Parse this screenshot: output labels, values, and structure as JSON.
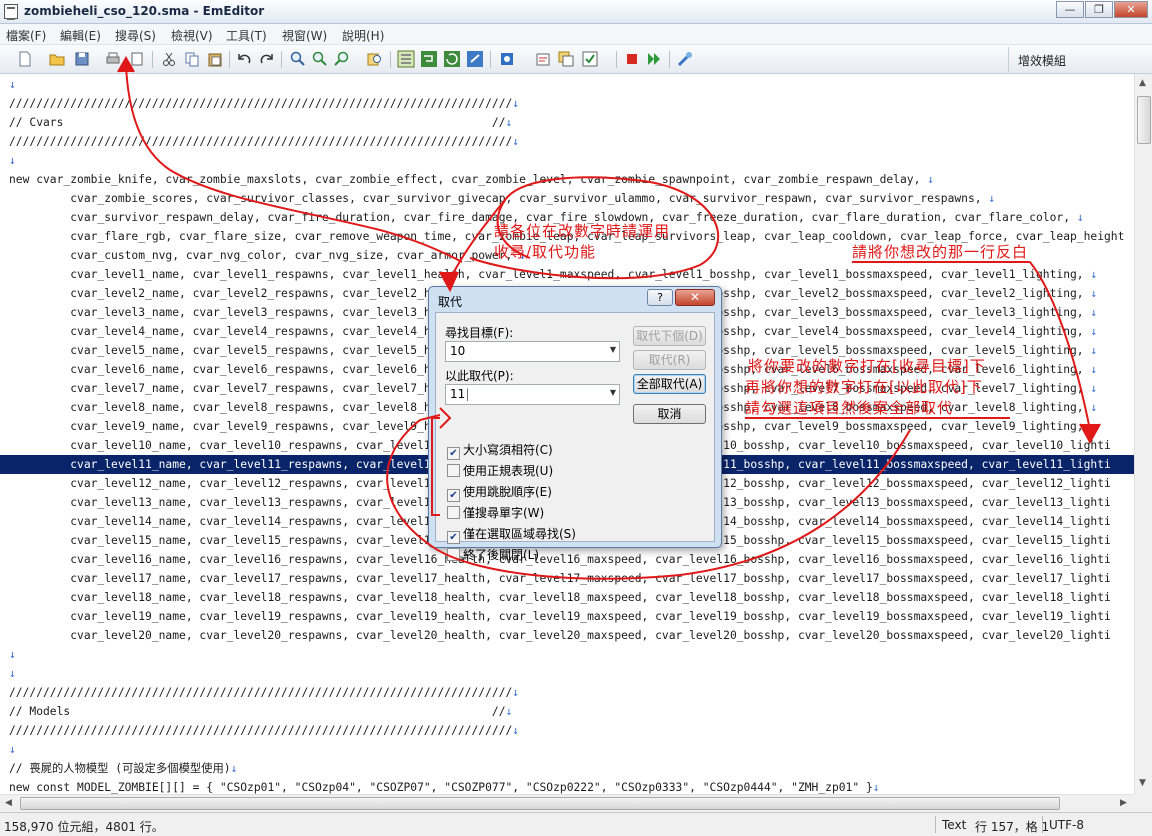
{
  "window": {
    "title": "zombieheli_cso_120.sma - EmEditor",
    "minimize": "—",
    "restore": "❐",
    "close": "✕"
  },
  "menu": [
    "檔案(F)",
    "編輯(E)",
    "搜尋(S)",
    "檢視(V)",
    "工具(T)",
    "視窗(W)",
    "說明(H)"
  ],
  "toolbar": {
    "plugin_panel": "增效模組"
  },
  "editor": {
    "crlf": "↓",
    "lines": [
      "",
      "//////////////////////////////////////////////////////////////////////////",
      "// Cvars                                                               //",
      "//////////////////////////////////////////////////////////////////////////",
      "",
      "new cvar_zombie_knife, cvar_zombie_maxslots, cvar_zombie_effect, cvar_zombie_level, cvar_zombie_spawnpoint, cvar_zombie_respawn_delay, ",
      "         cvar_zombie_scores, cvar_survivor_classes, cvar_survivor_givecap, cvar_survivor_ulammo, cvar_survivor_respawn, cvar_survivor_respawns, ",
      "         cvar_survivor_respawn_delay, cvar_fire_duration, cvar_fire_damage, cvar_fire_slowdown, cvar_freeze_duration, cvar_flare_duration, cvar_flare_color, ",
      "         cvar_flare_rgb, cvar_flare_size, cvar_remove_weapon_time, cvar_zombie_leap, cvar_leap_survivors_leap, cvar_leap_cooldown, cvar_leap_force, cvar_leap_height",
      "         cvar_custom_nvg, cvar_nvg_color, cvar_nvg_size, cvar_armor_power, ",
      "         cvar_level1_name, cvar_level1_respawns, cvar_level1_health, cvar_level1_maxspeed, cvar_level1_bosshp, cvar_level1_bossmaxspeed, cvar_level1_lighting, ",
      "         cvar_level2_name, cvar_level2_respawns, cvar_level2_health, cvar_level2_maxspeed, cvar_level2_bosshp, cvar_level2_bossmaxspeed, cvar_level2_lighting, ",
      "         cvar_level3_name, cvar_level3_respawns, cvar_level3_health, cvar_level3_maxspeed, cvar_level3_bosshp, cvar_level3_bossmaxspeed, cvar_level3_lighting, ",
      "         cvar_level4_name, cvar_level4_respawns, cvar_level4_health, cvar_level4_maxspeed, cvar_level4_bosshp, cvar_level4_bossmaxspeed, cvar_level4_lighting, ",
      "         cvar_level5_name, cvar_level5_respawns, cvar_level5_health, cvar_level5_maxspeed, cvar_level5_bosshp, cvar_level5_bossmaxspeed, cvar_level5_lighting, ",
      "         cvar_level6_name, cvar_level6_respawns, cvar_level6_health, cvar_level6_maxspeed, cvar_level6_bosshp, cvar_level6_bossmaxspeed, cvar_level6_lighting, ",
      "         cvar_level7_name, cvar_level7_respawns, cvar_level7_health, cvar_level7_maxspeed, cvar_level7_bosshp, cvar_level7_bossmaxspeed, cvar_level7_lighting, ",
      "         cvar_level8_name, cvar_level8_respawns, cvar_level8_health, cvar_level8_maxspeed, cvar_level8_bosshp, cvar_level8_bossmaxspeed, cvar_level8_lighting, ",
      "         cvar_level9_name, cvar_level9_respawns, cvar_level9_health, cvar_level9_maxspeed, cvar_level9_bosshp, cvar_level9_bossmaxspeed, cvar_level9_lighting, ",
      "         cvar_level10_name, cvar_level10_respawns, cvar_level10_health, cvar_level10_maxspeed, cvar_level10_bosshp, cvar_level10_bossmaxspeed, cvar_level10_lighti",
      "         cvar_level11_name, cvar_level11_respawns, cvar_level11_health, cvar_level11_maxspeed, cvar_level11_bosshp, cvar_level11_bossmaxspeed, cvar_level11_lighti",
      "         cvar_level12_name, cvar_level12_respawns, cvar_level12_health, cvar_level12_maxspeed, cvar_level12_bosshp, cvar_level12_bossmaxspeed, cvar_level12_lighti",
      "         cvar_level13_name, cvar_level13_respawns, cvar_level13_health, cvar_level13_maxspeed, cvar_level13_bosshp, cvar_level13_bossmaxspeed, cvar_level13_lighti",
      "         cvar_level14_name, cvar_level14_respawns, cvar_level14_health, cvar_level14_maxspeed, cvar_level14_bosshp, cvar_level14_bossmaxspeed, cvar_level14_lighti",
      "         cvar_level15_name, cvar_level15_respawns, cvar_level15_health, cvar_level15_maxspeed, cvar_level15_bosshp, cvar_level15_bossmaxspeed, cvar_level15_lighti",
      "         cvar_level16_name, cvar_level16_respawns, cvar_level16_health, cvar_level16_maxspeed, cvar_level16_bosshp, cvar_level16_bossmaxspeed, cvar_level16_lighti",
      "         cvar_level17_name, cvar_level17_respawns, cvar_level17_health, cvar_level17_maxspeed, cvar_level17_bosshp, cvar_level17_bossmaxspeed, cvar_level17_lighti",
      "         cvar_level18_name, cvar_level18_respawns, cvar_level18_health, cvar_level18_maxspeed, cvar_level18_bosshp, cvar_level18_bossmaxspeed, cvar_level18_lighti",
      "         cvar_level19_name, cvar_level19_respawns, cvar_level19_health, cvar_level19_maxspeed, cvar_level19_bosshp, cvar_level19_bossmaxspeed, cvar_level19_lighti",
      "         cvar_level20_name, cvar_level20_respawns, cvar_level20_health, cvar_level20_maxspeed, cvar_level20_bosshp, cvar_level20_bossmaxspeed, cvar_level20_lighti",
      "",
      "",
      "//////////////////////////////////////////////////////////////////////////",
      "// Models                                                              //",
      "//////////////////////////////////////////////////////////////////////////",
      "",
      "// 喪屍的人物模型 (可設定多個模型使用)",
      "new const MODEL_ZOMBIE[][] = { \"CSOzp01\", \"CSOzp04\", \"CSOZP07\", \"CSOZP077\", \"CSOzp0222\", \"CSOzp0333\", \"CSOzp0444\", \"ZMH_zp01\" }"
    ],
    "selected_line": 20,
    "no_crlf_lines": [
      8,
      19,
      20,
      21,
      22,
      23,
      24,
      25,
      26,
      27,
      28,
      29
    ]
  },
  "dialog": {
    "title": "取代",
    "help": "?",
    "close": "✕",
    "find_label": "尋找目標(F):",
    "find_value": "10",
    "replace_label": "以此取代(P):",
    "replace_value": "11",
    "buttons": {
      "replace_next": "取代下個(D)",
      "replace": "取代(R)",
      "replace_all": "全部取代(A)",
      "cancel": "取消"
    },
    "options": [
      {
        "label": "大小寫須相符(C)",
        "checked": true
      },
      {
        "label": "使用正規表現(U)",
        "checked": false
      },
      {
        "label": "使用跳脫順序(E)",
        "checked": true
      },
      {
        "label": "僅搜尋單字(W)",
        "checked": false
      },
      {
        "label": "僅在選取區域尋找(S)",
        "checked": true
      },
      {
        "label": "終了後關閉(L)",
        "checked": false
      }
    ]
  },
  "annotations": {
    "note1_line1": "請各位在改數字時請運用",
    "note1_line2": "收尋/取代功能",
    "note2": "請將你想改的那一行反白",
    "note3_line1": "將你要改的數字打在[收尋目標]下",
    "note3_line2": "再將你想的數字打在[以此取代]下",
    "note3_line3": "請勾選這項目然後案全部取代",
    "color": "#e01818"
  },
  "statusbar": {
    "size": "158,970 位元組，4801 行。",
    "mode": "Text",
    "position": "行 157，格 1",
    "encoding": "UTF-8"
  }
}
